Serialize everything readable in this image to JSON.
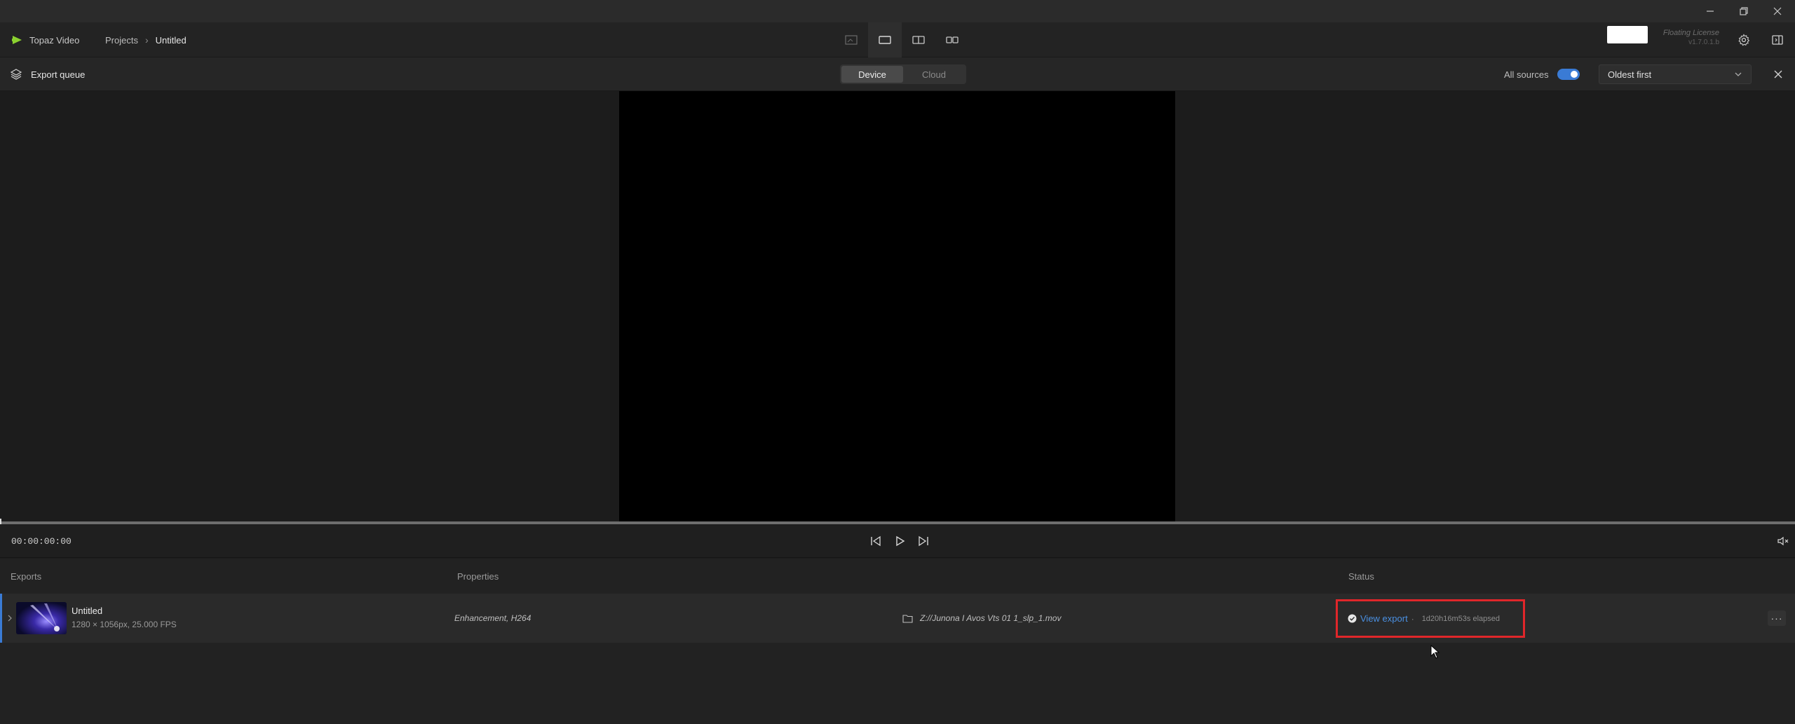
{
  "app": {
    "name": "Topaz Video",
    "accent_color": "#8bd12f"
  },
  "breadcrumb": {
    "projects": "Projects",
    "current": "Untitled"
  },
  "license": {
    "line1": "Floating License",
    "line2": "v1.7.0.1.b"
  },
  "queue": {
    "title": "Export queue",
    "tabs": [
      "Device",
      "Cloud"
    ],
    "active_tab": "Device",
    "all_sources_label": "All sources",
    "all_sources_on": true,
    "sort": "Oldest first"
  },
  "player": {
    "timecode": "00:00:00:00"
  },
  "table": {
    "columns": {
      "exports": "Exports",
      "properties": "Properties",
      "status": "Status"
    },
    "rows": [
      {
        "title": "Untitled",
        "subtitle": "1280 × 1056px, 25.000 FPS",
        "properties": "Enhancement, H264",
        "path": "Z://Junona I Avos Vts 01 1_slp_1.mov",
        "status_action": "View export",
        "separator": "·",
        "elapsed": "1d20h16m53s elapsed"
      }
    ]
  },
  "colors": {
    "highlight_border": "#e0262a",
    "link": "#4a90e2",
    "toggle": "#3a7bd5"
  }
}
